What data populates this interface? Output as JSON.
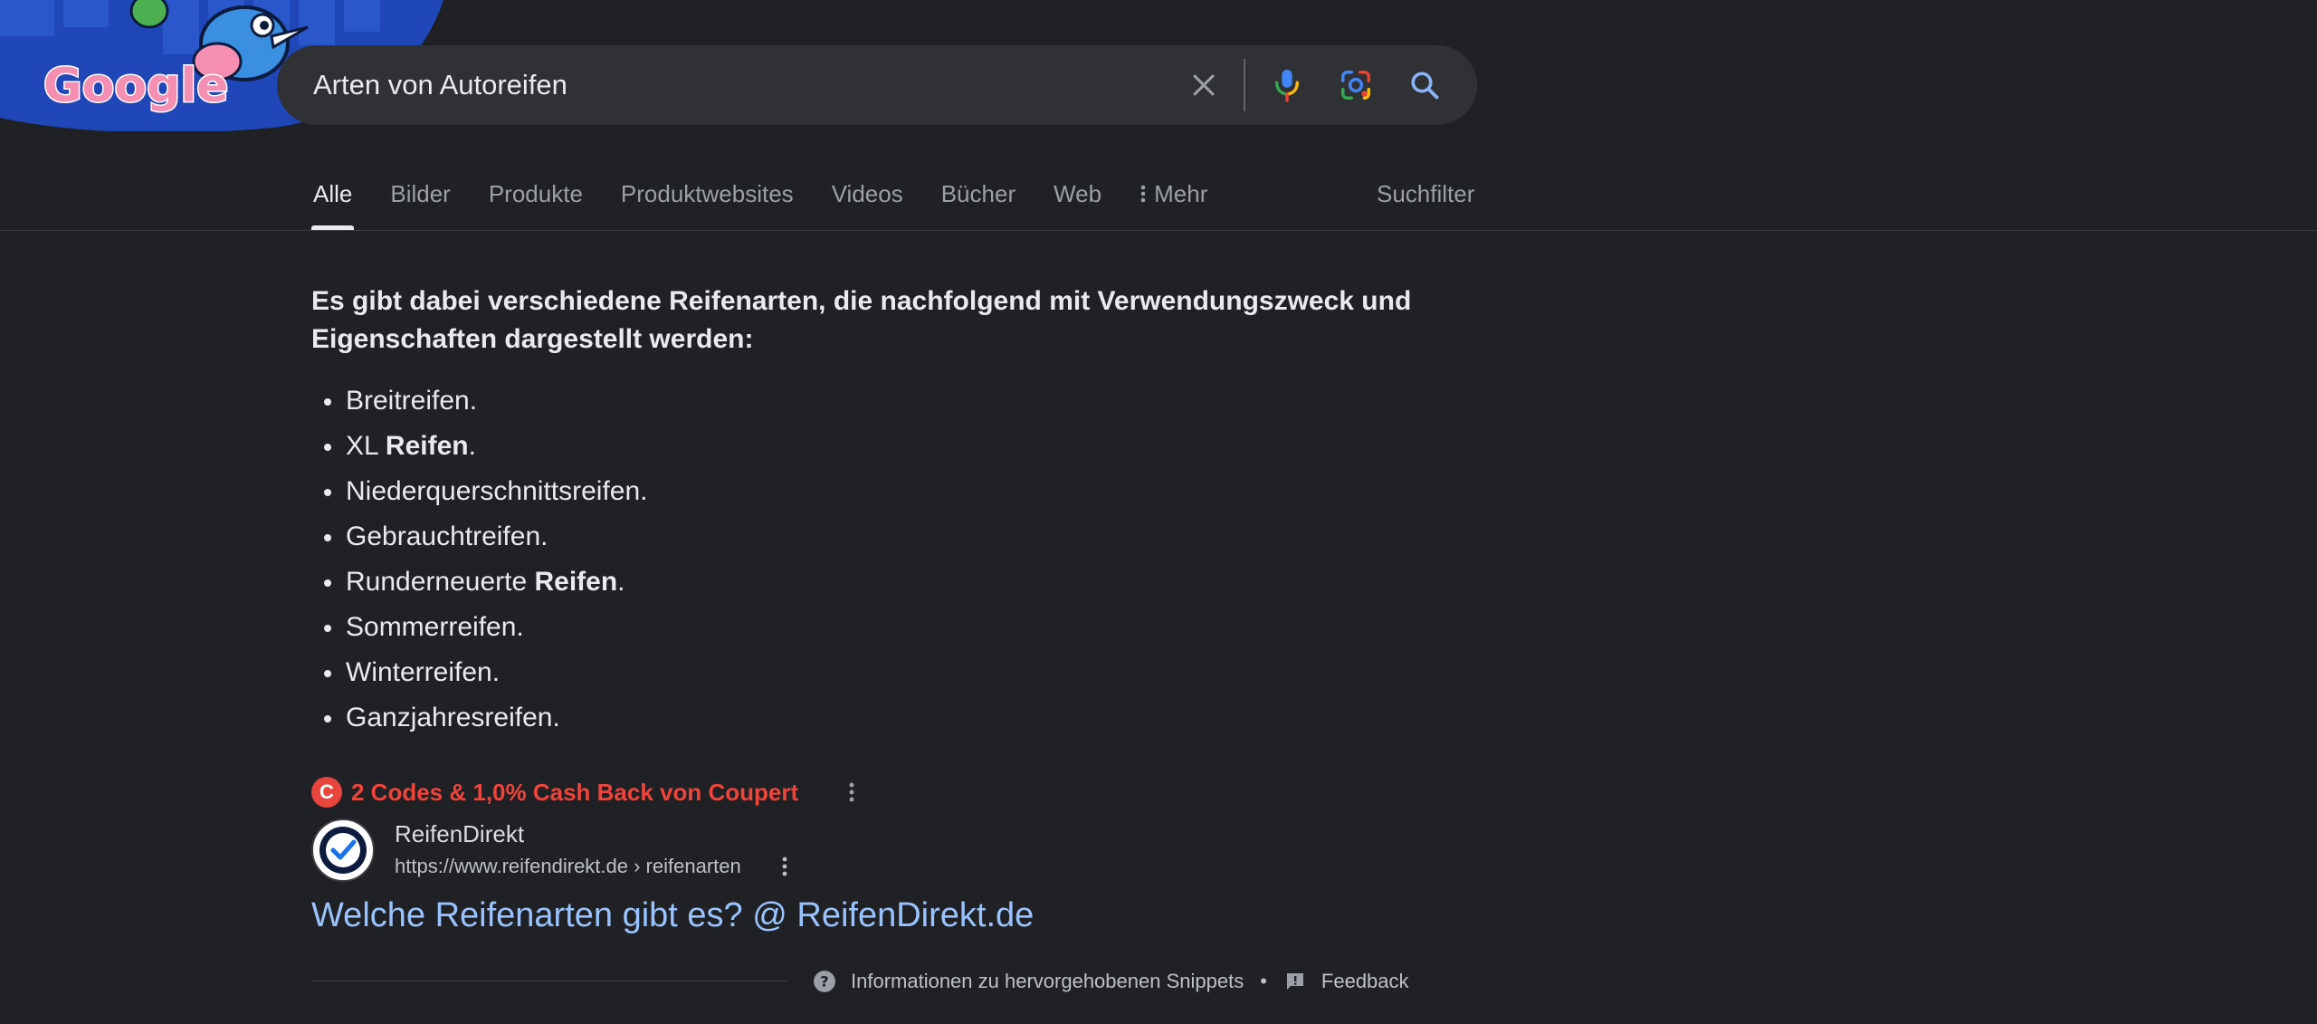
{
  "doodle": {
    "logo_text": "Google",
    "colors": {
      "sky": "#1f47b8",
      "wall": "#2a57c9",
      "bird": "#3a8fe0",
      "logo_pink": "#f48fb1"
    }
  },
  "search": {
    "query": "Arten von Autoreifen",
    "icons": [
      "close-icon",
      "microphone-icon",
      "lens-camera-icon",
      "search-icon"
    ]
  },
  "tabs": {
    "items": [
      {
        "label": "Alle",
        "active": true
      },
      {
        "label": "Bilder"
      },
      {
        "label": "Produkte"
      },
      {
        "label": "Produktwebsites"
      },
      {
        "label": "Videos"
      },
      {
        "label": "Bücher"
      },
      {
        "label": "Web"
      },
      {
        "label": "Mehr",
        "icon": "more-vertical-icon"
      }
    ],
    "filter_label": "Suchfilter"
  },
  "snippet": {
    "heading": "Es gibt dabei verschiedene Reifenarten, die nachfolgend mit Verwendungszweck und Eigenschaften dargestellt werden:",
    "items": [
      {
        "before": "Breitreifen.",
        "bold": "",
        "after": ""
      },
      {
        "before": "XL ",
        "bold": "Reifen",
        "after": "."
      },
      {
        "before": "Niederquerschnittsreifen.",
        "bold": "",
        "after": ""
      },
      {
        "before": "Gebrauchtreifen.",
        "bold": "",
        "after": ""
      },
      {
        "before": "Runderneuerte ",
        "bold": "Reifen",
        "after": "."
      },
      {
        "before": "Sommerreifen.",
        "bold": "",
        "after": ""
      },
      {
        "before": "Winterreifen.",
        "bold": "",
        "after": ""
      },
      {
        "before": "Ganzjahresreifen.",
        "bold": "",
        "after": ""
      }
    ]
  },
  "coupert": {
    "logo_letter": "C",
    "text": "2 Codes & 1,0% Cash Back von Coupert",
    "color": "#f0443a"
  },
  "source": {
    "name": "ReifenDirekt",
    "url": "https://www.reifendirekt.de › reifenarten",
    "title": "Welche Reifenarten gibt es? @ ReifenDirekt.de",
    "title_color": "#99c3ff"
  },
  "footer": {
    "info_label": "Informationen zu hervorgehobenen Snippets",
    "separator": "•",
    "feedback_label": "Feedback"
  }
}
